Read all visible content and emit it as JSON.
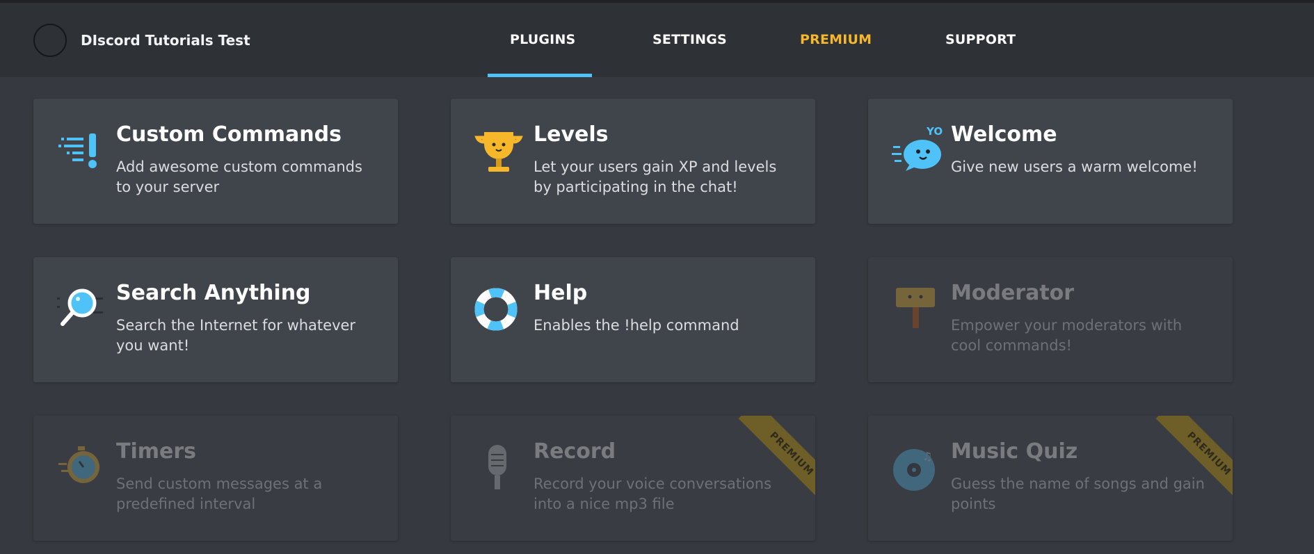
{
  "header": {
    "server_name": "DIscord Tutorials Test",
    "nav": [
      {
        "label": "PLUGINS",
        "active": true
      },
      {
        "label": "SETTINGS",
        "active": false
      },
      {
        "label": "PREMIUM",
        "active": false,
        "color": "#f6b82a"
      },
      {
        "label": "SUPPORT",
        "active": false
      }
    ],
    "active_color": "#4fc3f7"
  },
  "plugins": [
    {
      "title": "Custom Commands",
      "desc": "Add awesome custom commands to your server",
      "icon": "exclamation-icon",
      "enabled": true,
      "premium": false
    },
    {
      "title": "Levels",
      "desc": "Let your users gain XP and levels by participating in the chat!",
      "icon": "trophy-icon",
      "enabled": true,
      "premium": false
    },
    {
      "title": "Welcome",
      "desc": "Give new users a warm welcome!",
      "icon": "speech-bubble-icon",
      "icon_text": "YO",
      "enabled": true,
      "premium": false
    },
    {
      "title": "Search Anything",
      "desc": "Search the Internet for whatever you want!",
      "icon": "magnifier-icon",
      "enabled": true,
      "premium": false
    },
    {
      "title": "Help",
      "desc": "Enables the !help command",
      "icon": "lifebuoy-icon",
      "enabled": true,
      "premium": false
    },
    {
      "title": "Moderator",
      "desc": "Empower your moderators with cool commands!",
      "icon": "hammer-icon",
      "enabled": false,
      "premium": false
    },
    {
      "title": "Timers",
      "desc": "Send custom messages at a predefined interval",
      "icon": "stopwatch-icon",
      "enabled": false,
      "premium": false
    },
    {
      "title": "Record",
      "desc": "Record your voice conversations into a nice mp3 file",
      "icon": "microphone-icon",
      "enabled": false,
      "premium": true
    },
    {
      "title": "Music Quiz",
      "desc": "Guess the name of songs and gain points",
      "icon": "music-disc-icon",
      "enabled": false,
      "premium": true
    }
  ],
  "premium_badge": "PREMIUM"
}
